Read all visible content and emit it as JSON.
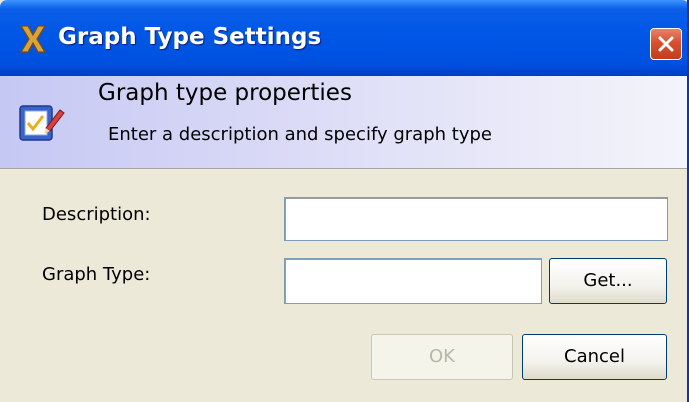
{
  "window": {
    "title": "Graph Type Settings",
    "app_icon": "x-app-icon",
    "close_icon": "close-icon"
  },
  "banner": {
    "title": "Graph type properties",
    "subtitle": "Enter a description and specify graph type",
    "icon": "checklist-pencil-icon"
  },
  "form": {
    "description_label": "Description:",
    "description_value": "",
    "graph_type_label": "Graph Type:",
    "graph_type_value": "",
    "get_button": "Get..."
  },
  "footer": {
    "ok_button": "OK",
    "ok_enabled": false,
    "cancel_button": "Cancel"
  },
  "colors": {
    "titlebar": "#0054e3",
    "dialog_bg": "#ece9d8",
    "close_button": "#d9502f"
  }
}
